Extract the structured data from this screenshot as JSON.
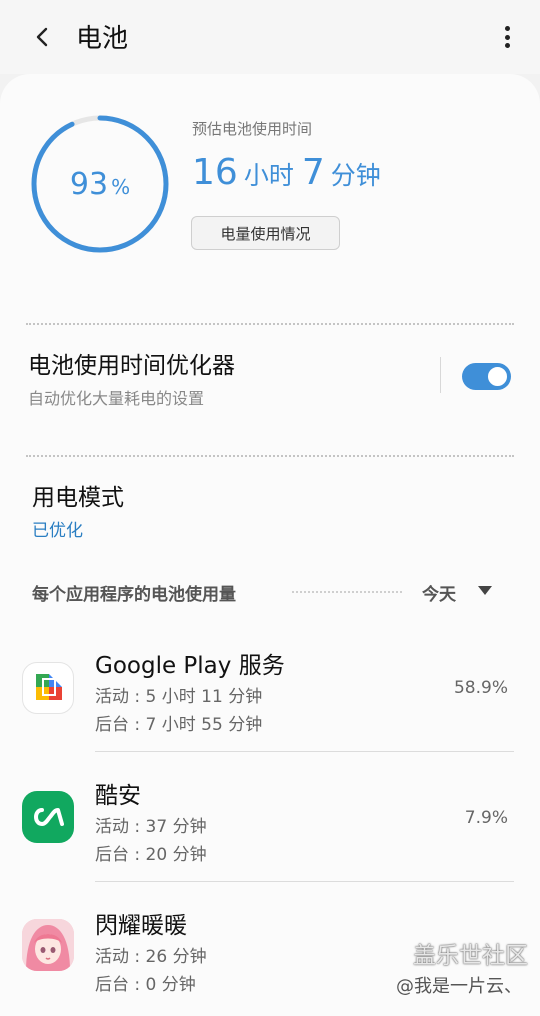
{
  "appbar": {
    "title": "电池",
    "back_icon": "chevron-left-icon",
    "more_icon": "more-vert-icon"
  },
  "battery": {
    "percent": "93",
    "percent_unit": "%",
    "level_fraction": 0.93,
    "estimate_label": "预估电池使用时间",
    "hours": "16",
    "hours_unit": "小时",
    "minutes": "7",
    "minutes_unit": "分钟",
    "usage_button": "电量使用情况",
    "accent_color": "#3f8fd8"
  },
  "optimizer": {
    "title": "电池使用时间优化器",
    "subtitle": "自动优化大量耗电的设置",
    "enabled": true
  },
  "power_mode": {
    "title": "用电模式",
    "value": "已优化"
  },
  "per_app": {
    "header": "每个应用程序的电池使用量",
    "period": "今天"
  },
  "apps": [
    {
      "name": "Google Play 服务",
      "active": "活动 : 5 小时 11 分钟",
      "background": "后台 : 7 小时 55 分钟",
      "percent": "58.9%",
      "icon": "google-play-services-icon"
    },
    {
      "name": "酷安",
      "active": "活动 : 37 分钟",
      "background": "后台 : 20 分钟",
      "percent": "7.9%",
      "icon": "coolapk-icon"
    },
    {
      "name": "閃耀暖暖",
      "active": "活动 : 26 分钟",
      "background": "后台 : 0 分钟",
      "percent": "",
      "icon": "shining-nikki-icon"
    }
  ],
  "watermark": {
    "line1": "盖乐世社区",
    "line2": "@我是一片云、"
  }
}
